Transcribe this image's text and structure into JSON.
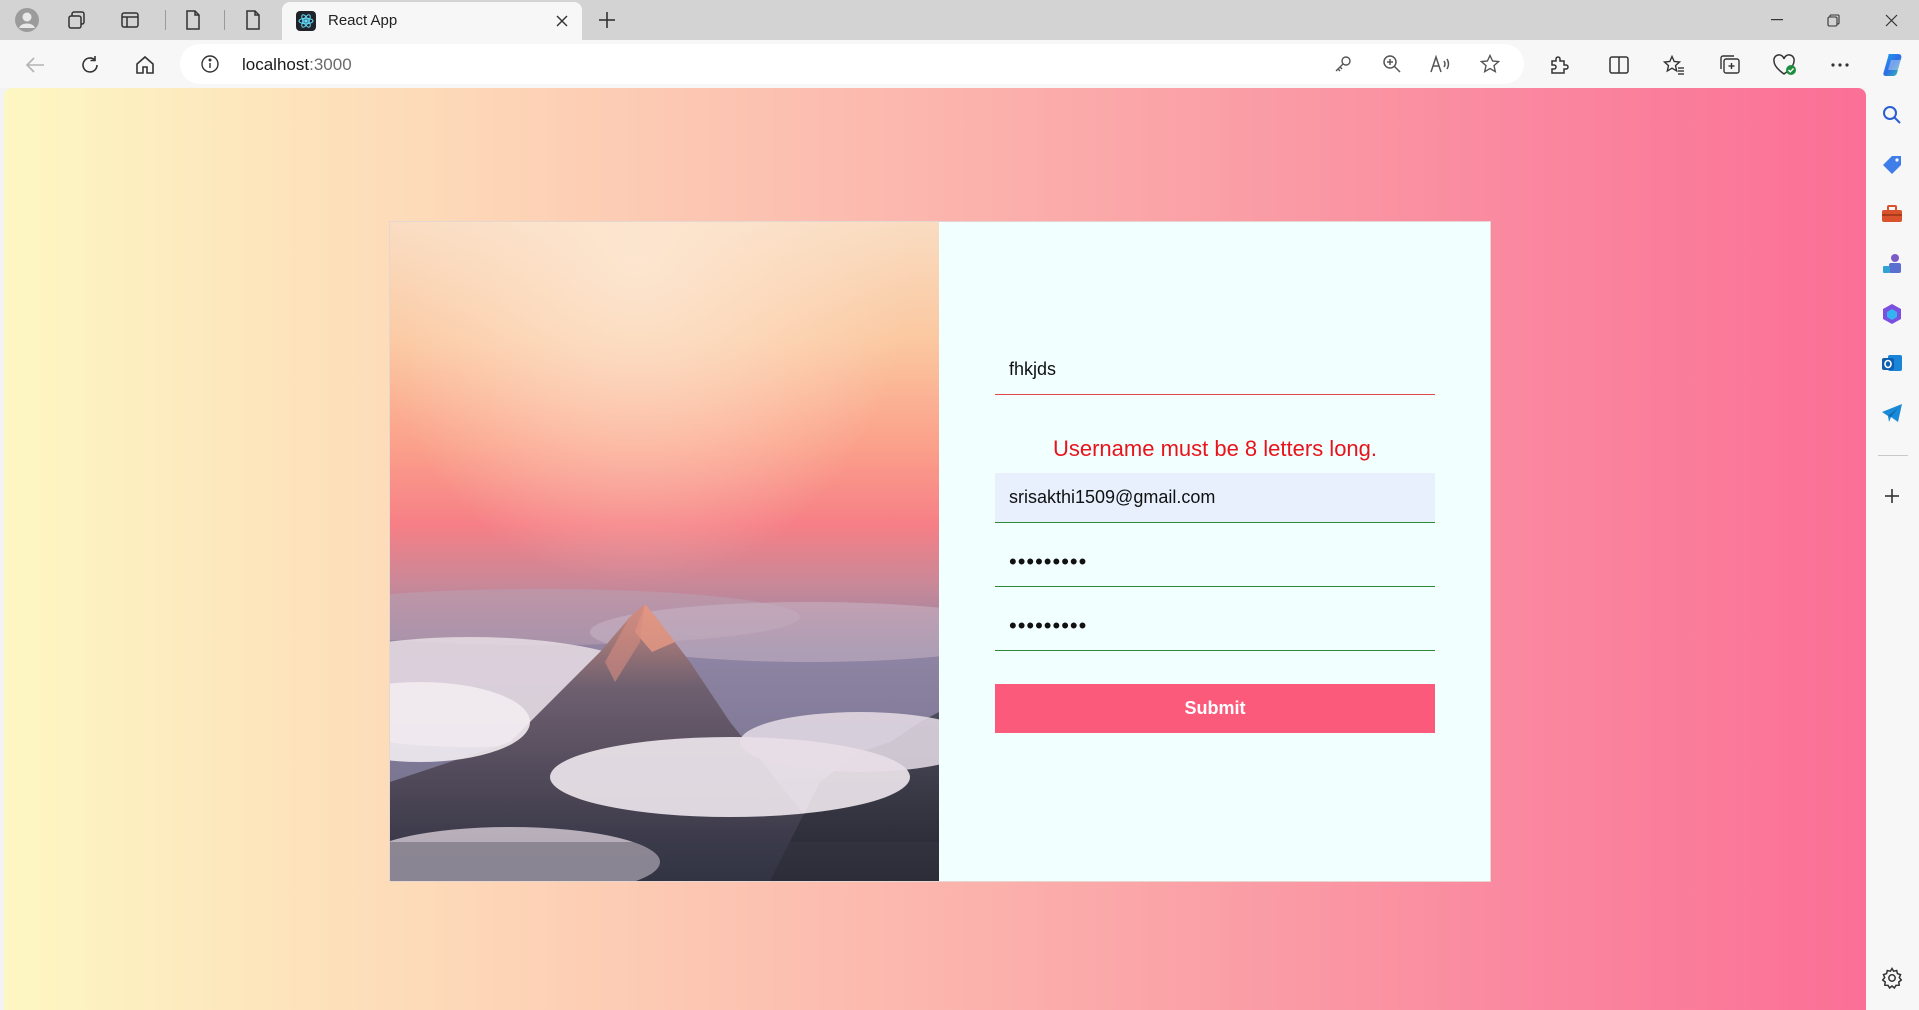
{
  "browser": {
    "tab": {
      "title": "React App"
    },
    "address": {
      "host": "localhost",
      "port": ":3000"
    }
  },
  "form": {
    "username": {
      "value": "fhkjds"
    },
    "username_error": "Username must be 8 letters long.",
    "email": {
      "value": "srisakthi1509@gmail.com"
    },
    "password": {
      "value": "•••••••••"
    },
    "confirm_password": {
      "value": "•••••••••"
    },
    "submit_label": "Submit"
  },
  "colors": {
    "accent": "#fb5a7b",
    "error": "#e8141c",
    "valid_underline": "#2e8a3a",
    "card_background": "#f1fffe"
  },
  "icons": {
    "tabbar": [
      "profile-icon",
      "workspaces-icon",
      "tab-actions-icon",
      "document-icon",
      "document-icon",
      "new-tab-icon"
    ],
    "toolbar": [
      "back-icon",
      "refresh-icon",
      "home-icon",
      "info-icon",
      "key-icon",
      "zoom-icon",
      "read-aloud-icon",
      "favorite-icon",
      "extensions-icon",
      "split-screen-icon",
      "favorites-icon",
      "collections-icon",
      "browser-essentials-icon",
      "more-icon",
      "copilot-icon"
    ],
    "sidebar": [
      "search-icon",
      "shopping-icon",
      "tools-icon",
      "games-icon",
      "microsoft-365-icon",
      "outlook-icon",
      "telegram-icon",
      "add-icon",
      "settings-icon"
    ]
  }
}
